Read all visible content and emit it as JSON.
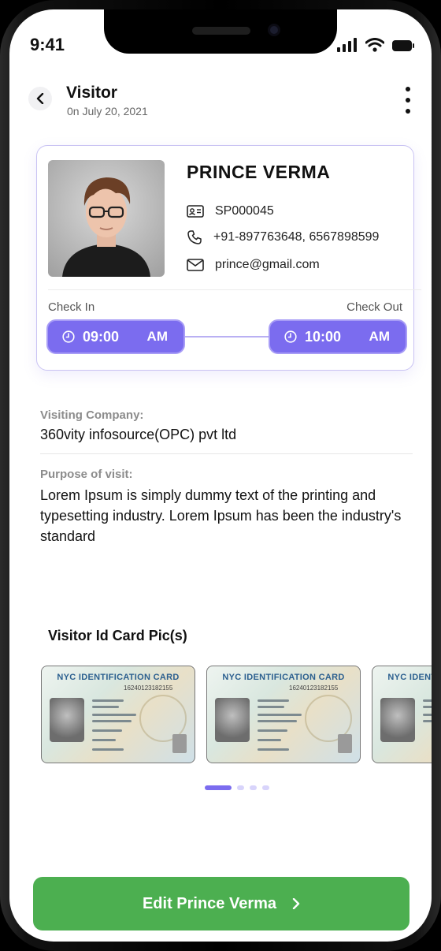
{
  "status_bar": {
    "time": "9:41"
  },
  "header": {
    "title": "Visitor",
    "subtitle": "0n July 20, 2021"
  },
  "visitor": {
    "name": "PRINCE VERMA",
    "id": "SP000045",
    "phone": "+91-897763648, 6567898599",
    "email": "prince@gmail.com"
  },
  "timing": {
    "check_in_label": "Check In",
    "check_out_label": "Check Out",
    "check_in_time": "09:00",
    "check_in_ampm": "AM",
    "check_out_time": "10:00",
    "check_out_ampm": "AM"
  },
  "details": {
    "company_label": "Visiting Company:",
    "company_value": "360vity infosource(OPC) pvt ltd",
    "purpose_label": "Purpose of visit:",
    "purpose_value": "Lorem Ipsum is simply dummy text of the printing and typesetting industry. Lorem Ipsum has been the industry's standard"
  },
  "id_cards": {
    "title": "Visitor Id Card Pic(s)",
    "card_heading": "NYC IDENTIFICATION CARD",
    "card_number": "16240123182155",
    "pager_total": 4,
    "pager_active": 0
  },
  "action": {
    "edit_label": "Edit Prince Verma"
  },
  "colors": {
    "accent": "#7b6cef",
    "primary_button": "#4caf50",
    "card_border": "#c9c3f3"
  },
  "icons": {
    "back": "chevron-left-icon",
    "more": "more-vertical-icon",
    "id": "id-card-icon",
    "phone": "phone-icon",
    "email": "mail-icon",
    "clock": "clock-icon",
    "forward": "chevron-right-icon"
  }
}
